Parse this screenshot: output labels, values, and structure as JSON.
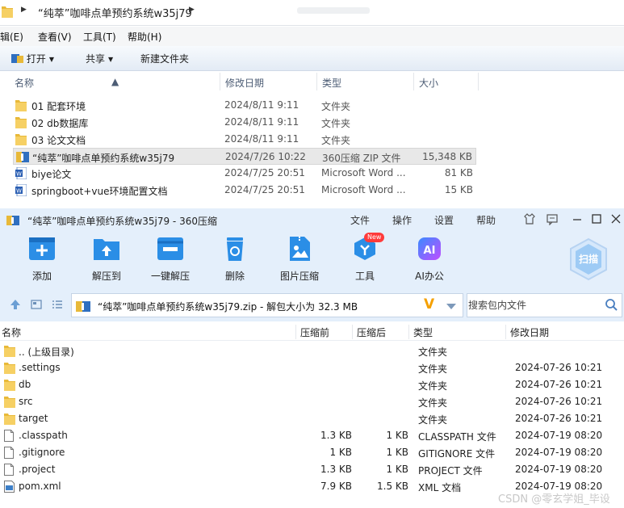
{
  "explorer": {
    "breadcrumb": "“纯萃”咖啡点单预约系统w35j79",
    "menu": [
      "辑(E)",
      "查看(V)",
      "工具(T)",
      "帮助(H)"
    ],
    "toolbar": {
      "open": "打开",
      "share": "共享",
      "new_folder": "新建文件夹"
    },
    "columns": {
      "name": "名称",
      "date": "修改日期",
      "type": "类型",
      "size": "大小"
    },
    "rows": [
      {
        "name": "01 配套环境",
        "date": "2024/8/11 9:11",
        "type": "文件夹",
        "size": "",
        "icon": "folder-icon"
      },
      {
        "name": "02 db数据库",
        "date": "2024/8/11 9:11",
        "type": "文件夹",
        "size": "",
        "icon": "folder-icon"
      },
      {
        "name": "03 论文文档",
        "date": "2024/8/11 9:11",
        "type": "文件夹",
        "size": "",
        "icon": "folder-icon"
      },
      {
        "name": "“纯萃”咖啡点单预约系统w35j79",
        "date": "2024/7/26 10:22",
        "type": "360压缩 ZIP 文件",
        "size": "15,348 KB",
        "icon": "zip-archive-icon"
      },
      {
        "name": "biye论文",
        "date": "2024/7/25 20:51",
        "type": "Microsoft Word ...",
        "size": "81 KB",
        "icon": "word-doc-icon"
      },
      {
        "name": "springboot+vue环境配置文档",
        "date": "2024/7/25 20:51",
        "type": "Microsoft Word ...",
        "size": "15 KB",
        "icon": "word-doc-icon"
      }
    ]
  },
  "archiver": {
    "title": "“纯萃”咖啡点单预约系统w35j79 - 360压缩",
    "menu": [
      "文件",
      "操作",
      "设置",
      "帮助"
    ],
    "tools": [
      {
        "label": "添加",
        "icon": "add-icon"
      },
      {
        "label": "解压到",
        "icon": "extract-to-icon"
      },
      {
        "label": "一键解压",
        "icon": "one-click-extract-icon"
      },
      {
        "label": "删除",
        "icon": "delete-icon"
      },
      {
        "label": "图片压缩",
        "icon": "image-compress-icon"
      },
      {
        "label": "工具",
        "icon": "tools-icon"
      },
      {
        "label": "AI办公",
        "icon": "ai-office-icon"
      }
    ],
    "new_badge": "New",
    "scan_label": "扫描",
    "path": "“纯萃”咖啡点单预约系统w35j79.zip - 解包大小为 32.3 MB",
    "search_placeholder": "搜索包内文件",
    "columns": {
      "name": "名称",
      "compressed_before": "压缩前",
      "compressed_after": "压缩后",
      "type": "类型",
      "date": "修改日期"
    },
    "rows": [
      {
        "name": ".. (上级目录)",
        "before": "",
        "after": "",
        "type": "文件夹",
        "date": "",
        "icon": "folder-icon"
      },
      {
        "name": ".settings",
        "before": "",
        "after": "",
        "type": "文件夹",
        "date": "2024-07-26 10:21",
        "icon": "folder-icon"
      },
      {
        "name": "db",
        "before": "",
        "after": "",
        "type": "文件夹",
        "date": "2024-07-26 10:21",
        "icon": "folder-icon"
      },
      {
        "name": "src",
        "before": "",
        "after": "",
        "type": "文件夹",
        "date": "2024-07-26 10:21",
        "icon": "folder-icon"
      },
      {
        "name": "target",
        "before": "",
        "after": "",
        "type": "文件夹",
        "date": "2024-07-26 10:21",
        "icon": "folder-icon"
      },
      {
        "name": ".classpath",
        "before": "1.3 KB",
        "after": "1 KB",
        "type": "CLASSPATH 文件",
        "date": "2024-07-19 08:20",
        "icon": "file-icon"
      },
      {
        "name": ".gitignore",
        "before": "1 KB",
        "after": "1 KB",
        "type": "GITIGNORE 文件",
        "date": "2024-07-19 08:20",
        "icon": "file-icon"
      },
      {
        "name": ".project",
        "before": "1.3 KB",
        "after": "1 KB",
        "type": "PROJECT 文件",
        "date": "2024-07-19 08:20",
        "icon": "file-icon"
      },
      {
        "name": "pom.xml",
        "before": "7.9 KB",
        "after": "1.5 KB",
        "type": "XML 文档",
        "date": "2024-07-19 08:20",
        "icon": "xml-file-icon"
      }
    ]
  },
  "watermark": "CSDN @零玄学姐_毕设"
}
